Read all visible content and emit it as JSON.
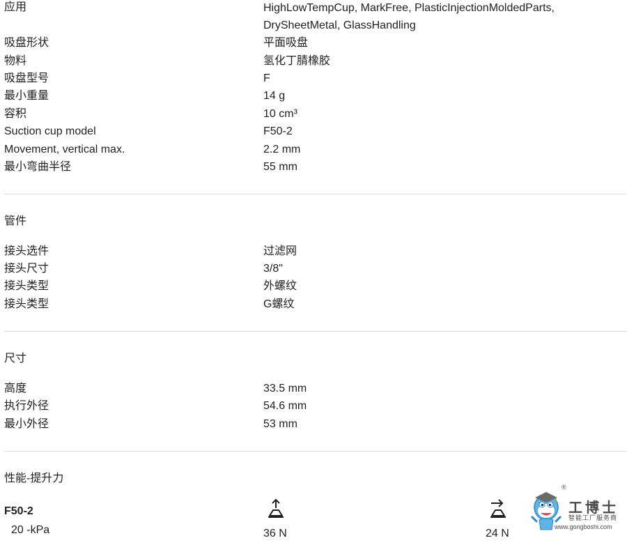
{
  "specs": [
    {
      "label": "应用",
      "value_lines": [
        "HighLowTempCup, MarkFree, PlasticInjectionMoldedParts,",
        "DrySheetMetal, GlassHandling"
      ]
    },
    {
      "label": "吸盘形状",
      "value": "平面吸盘"
    },
    {
      "label": "物料",
      "value": "氢化丁腈橡胶"
    },
    {
      "label": "吸盘型号",
      "value": "F"
    },
    {
      "label": "最小重量",
      "value": "14 g"
    },
    {
      "label": "容积",
      "value": "10 cm³"
    },
    {
      "label": "Suction cup model",
      "value": "F50-2"
    },
    {
      "label": "Movement, vertical max.",
      "value": "2.2 mm"
    },
    {
      "label": "最小弯曲半径",
      "value": "55 mm"
    }
  ],
  "fittings": {
    "heading": "管件",
    "rows": [
      {
        "label": "接头选件",
        "value": "过滤网"
      },
      {
        "label": "接头尺寸",
        "value": "3/8\""
      },
      {
        "label": "接头类型",
        "value": "外螺纹"
      },
      {
        "label": "接头类型",
        "value": "G螺纹"
      }
    ]
  },
  "dimensions": {
    "heading": "尺寸",
    "rows": [
      {
        "label": "高度",
        "value": "33.5 mm"
      },
      {
        "label": "执行外径",
        "value": "54.6 mm"
      },
      {
        "label": "最小外径",
        "value": "53 mm"
      }
    ]
  },
  "performance": {
    "heading": "性能-提升力",
    "model": "F50-2",
    "pressure": "20 -kPa",
    "vertical_force": "36 N",
    "horizontal_force": "24 N",
    "vertical_icon": "vertical-lift-icon",
    "horizontal_icon": "horizontal-lift-icon"
  },
  "watermark": {
    "brand": "工博士",
    "tagline": "智能工厂服务商",
    "url": "www.gongboshi.com",
    "registered": "®"
  }
}
